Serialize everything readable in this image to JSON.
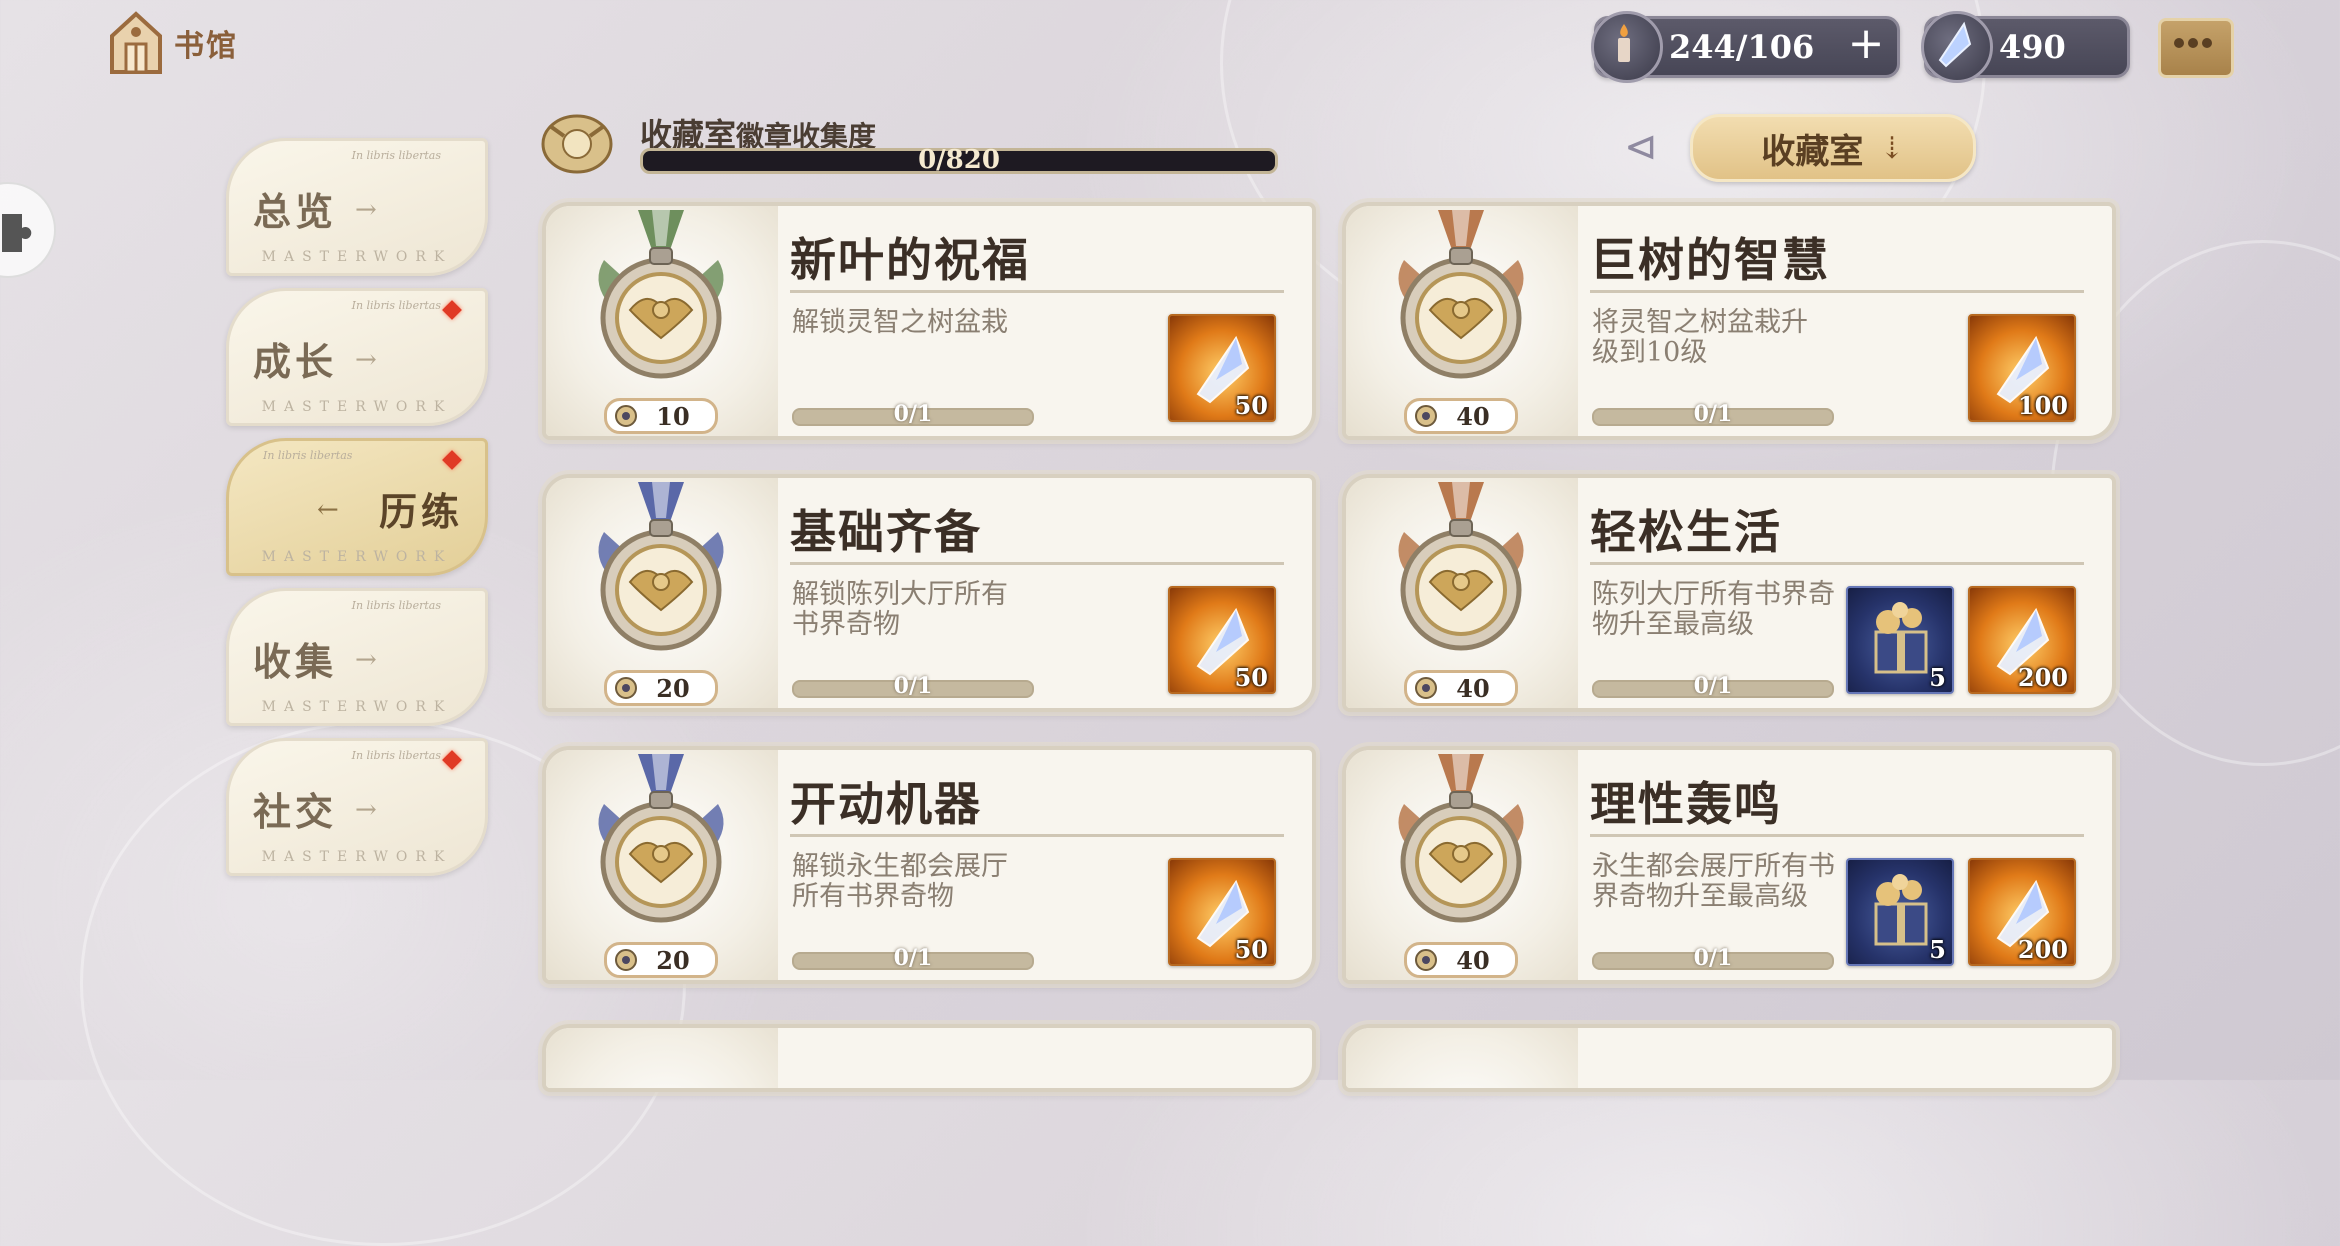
{
  "header": {
    "home_label": "书馆",
    "stamina": "244/106",
    "crystals": "490"
  },
  "nav": [
    {
      "label": "总览",
      "tag": "In libris libertas",
      "mark": "MASTERWORK",
      "alert": false,
      "active": false
    },
    {
      "label": "成长",
      "tag": "In libris libertas",
      "mark": "MASTERWORK",
      "alert": true,
      "active": false
    },
    {
      "label": "历练",
      "tag": "In libris libertas",
      "mark": "MASTERWORK",
      "alert": true,
      "active": true
    },
    {
      "label": "收集",
      "tag": "In libris libertas",
      "mark": "MASTERWORK",
      "alert": false,
      "active": false
    },
    {
      "label": "社交",
      "tag": "In libris libertas",
      "mark": "MASTERWORK",
      "alert": true,
      "active": false
    }
  ],
  "collection": {
    "title": "收藏室",
    "subtitle": "徽章收集度",
    "progress": "0/820",
    "button_label": "收藏室"
  },
  "cards": [
    {
      "title": "新叶的祝福",
      "desc": "解锁灵智之树盆栽",
      "points": "10",
      "progress": "0/1",
      "ribbon": "#6e8f5d",
      "rewards": [
        {
          "type": "crystal",
          "qty": "50"
        }
      ]
    },
    {
      "title": "巨树的智慧",
      "desc": "将灵智之树盆栽升级到10级",
      "points": "40",
      "progress": "0/1",
      "ribbon": "#b9794e",
      "rewards": [
        {
          "type": "crystal",
          "qty": "100"
        }
      ]
    },
    {
      "title": "基础齐备",
      "desc": "解锁陈列大厅所有书界奇物",
      "points": "20",
      "progress": "0/1",
      "ribbon": "#5a68a8",
      "rewards": [
        {
          "type": "crystal",
          "qty": "50"
        }
      ]
    },
    {
      "title": "轻松生活",
      "desc": "陈列大厅所有书界奇物升至最高级",
      "points": "40",
      "progress": "0/1",
      "ribbon": "#b9794e",
      "rewards": [
        {
          "type": "gift",
          "qty": "5"
        },
        {
          "type": "crystal",
          "qty": "200"
        }
      ]
    },
    {
      "title": "开动机器",
      "desc": "解锁永生都会展厅所有书界奇物",
      "points": "20",
      "progress": "0/1",
      "ribbon": "#5a68a8",
      "rewards": [
        {
          "type": "crystal",
          "qty": "50"
        }
      ]
    },
    {
      "title": "理性轰鸣",
      "desc": "永生都会展厅所有书界奇物升至最高级",
      "points": "40",
      "progress": "0/1",
      "ribbon": "#b9794e",
      "rewards": [
        {
          "type": "gift",
          "qty": "5"
        },
        {
          "type": "crystal",
          "qty": "200"
        }
      ]
    }
  ]
}
